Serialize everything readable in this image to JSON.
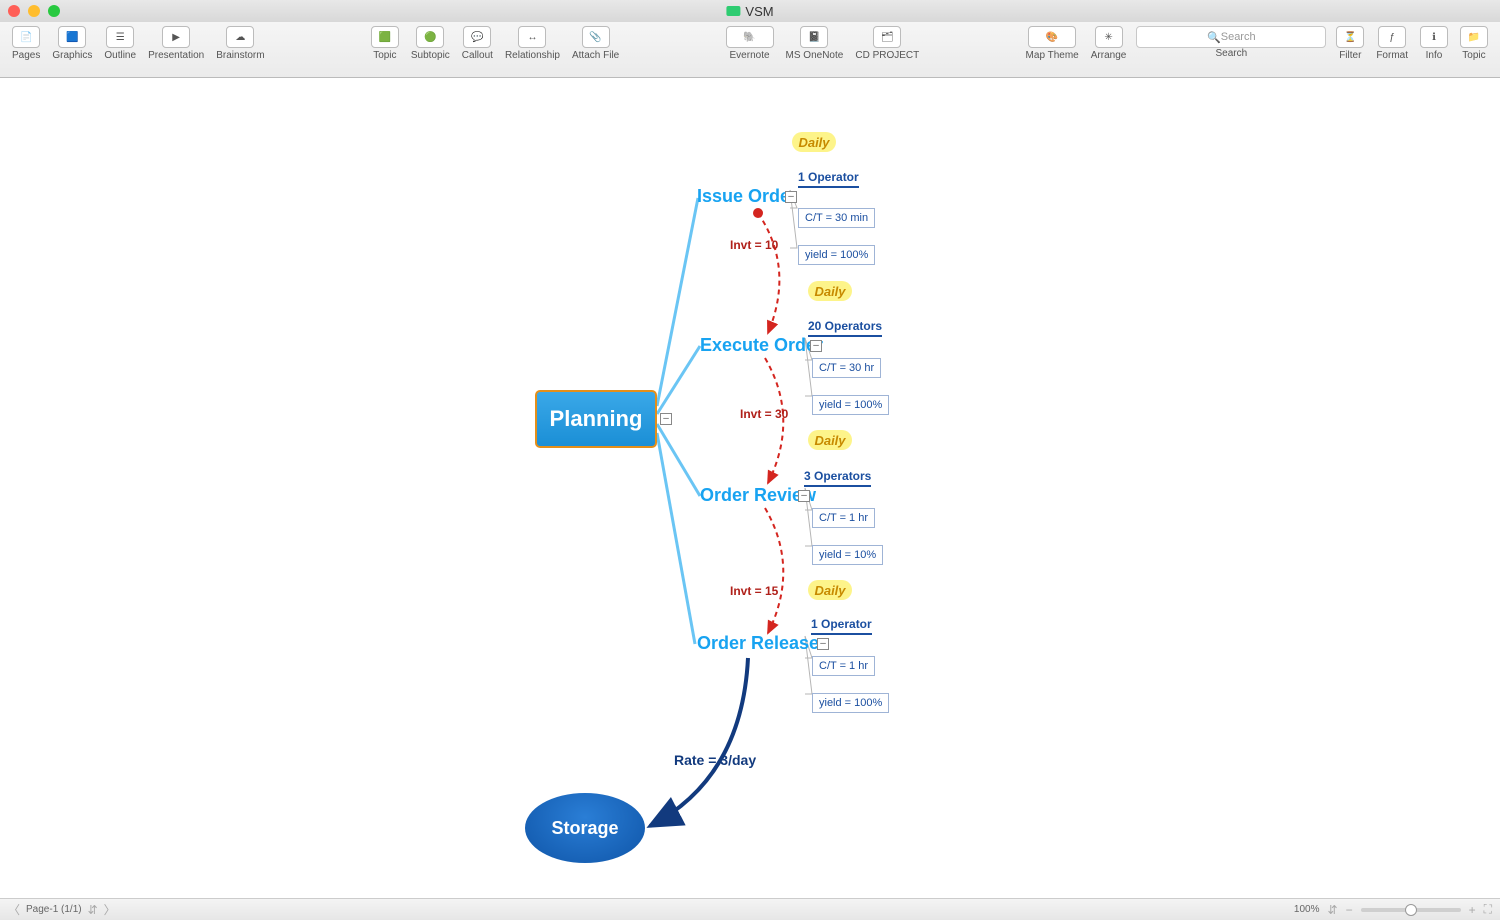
{
  "window_title": "VSM",
  "toolbar": {
    "left": [
      "Pages",
      "Graphics",
      "Outline",
      "Presentation",
      "Brainstorm"
    ],
    "mid1": [
      "Topic",
      "Subtopic",
      "Callout",
      "Relationship",
      "Attach File"
    ],
    "mid2": [
      "Evernote",
      "MS OneNote",
      "CD PROJECT"
    ],
    "right1": [
      "Map Theme",
      "Arrange"
    ],
    "right2": [
      "Filter",
      "Format",
      "Info",
      "Topic"
    ],
    "search_label": "Search",
    "search_placeholder": "Search"
  },
  "root": "Planning",
  "dailies": [
    "Daily",
    "Daily",
    "Daily",
    "Daily"
  ],
  "invt": [
    "Invt = 10",
    "Invt = 30",
    "Invt = 15"
  ],
  "rate": "Rate = 3/day",
  "storage": "Storage",
  "nodes": [
    {
      "name": "Issue Order",
      "ops": "1 Operator",
      "ct": "C/T = 30 min",
      "yield": "yield = 100%"
    },
    {
      "name": "Execute Order",
      "ops": "20 Operators",
      "ct": "C/T = 30 hr",
      "yield": "yield = 100%"
    },
    {
      "name": "Order Review",
      "ops": "3 Operators",
      "ct": "C/T = 1 hr",
      "yield": "yield = 10%"
    },
    {
      "name": "Order Release",
      "ops": "1 Operator",
      "ct": "C/T = 1 hr",
      "yield": "yield = 100%"
    }
  ],
  "status": {
    "page": "Page-1 (1/1)",
    "zoom": "100%"
  }
}
